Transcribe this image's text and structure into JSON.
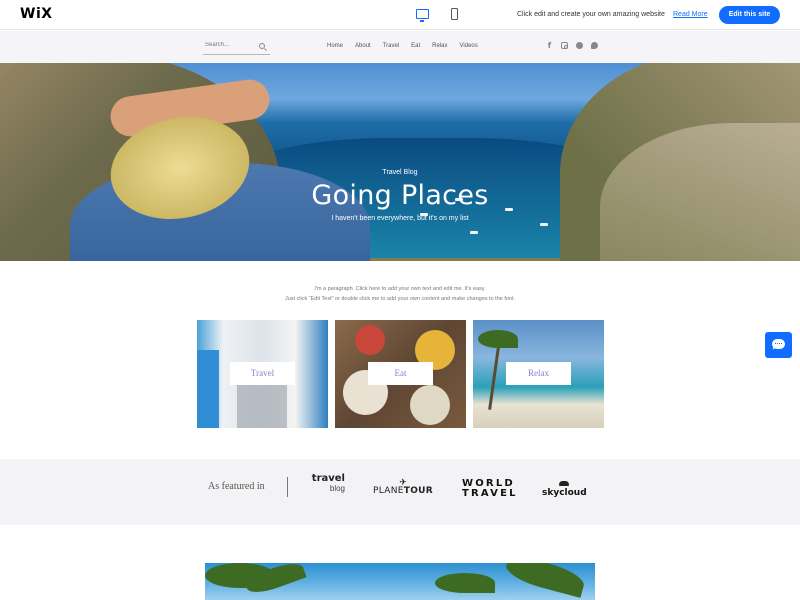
{
  "wix_bar": {
    "logo": "WiX",
    "message": "Click edit and create your own amazing website",
    "read_more": "Read More",
    "edit_button": "Edit this site",
    "accent": "#116dff"
  },
  "header": {
    "search_placeholder": "Search...",
    "nav": [
      "Home",
      "About",
      "Travel",
      "Eat",
      "Relax",
      "Videos"
    ],
    "social_icons": [
      "facebook-icon",
      "instagram-icon",
      "pinterest-icon",
      "twitter-icon"
    ]
  },
  "hero": {
    "kicker": "Travel Blog",
    "title": "Going Places",
    "subtitle": "I haven't been everywhere, but it's on my list"
  },
  "intro": {
    "line1": "I'm a paragraph. Click here to add your own text and edit me. It's easy.",
    "line2": "Just click “Edit Text” or double click me to add your own content and make changes to the font."
  },
  "cards": [
    {
      "label": "Travel"
    },
    {
      "label": "Eat"
    },
    {
      "label": "Relax"
    }
  ],
  "featured": {
    "label": "As featured in",
    "logos": {
      "travel_blog_line1": "travel",
      "travel_blog_line2": "blog",
      "planetour_part1": "PLANE",
      "planetour_part2": "TOUR",
      "world_travel_line1": "WORLD",
      "world_travel_line2": "TRAVEL",
      "skycloud": "skycloud"
    }
  },
  "colors": {
    "accent": "#116dff",
    "card_label": "#8a7fd0",
    "featured_bg": "#f3f3f5"
  }
}
